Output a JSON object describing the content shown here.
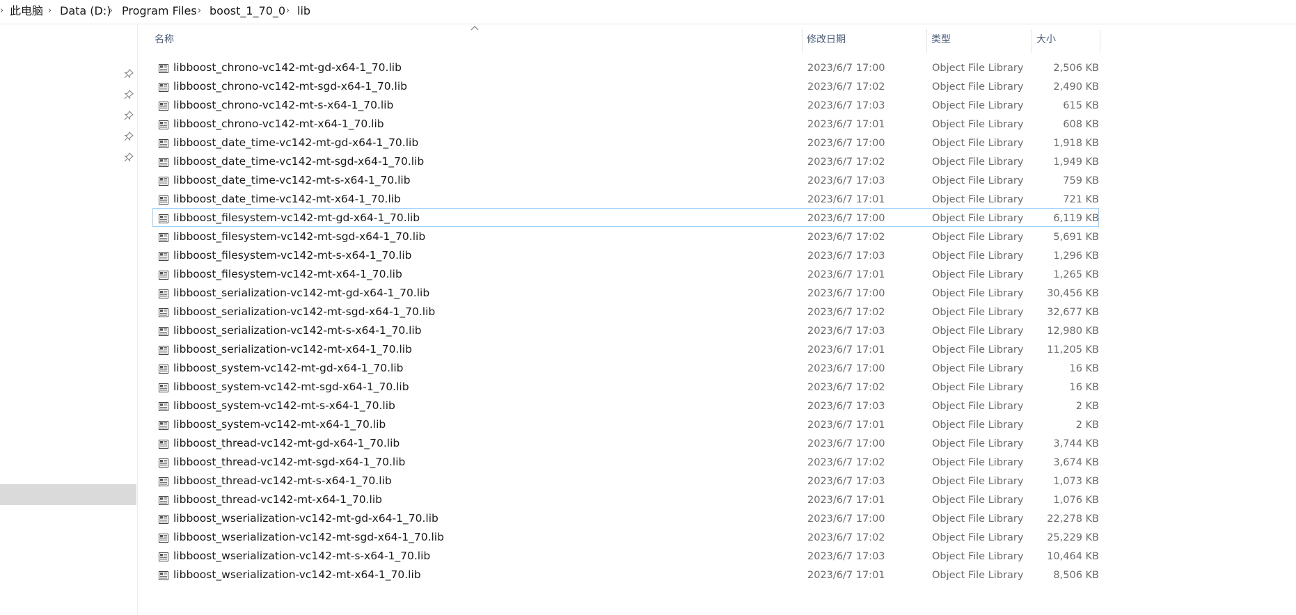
{
  "breadcrumb": [
    "此电脑",
    "Data (D:)",
    "Program Files",
    "boost_1_70_0",
    "lib"
  ],
  "columns": {
    "name": "名称",
    "modified": "修改日期",
    "type": "类型",
    "size": "大小"
  },
  "icons": {
    "breadcrumb_separator": "chevron-right-icon",
    "pin": "pin-icon",
    "file": "lib-file-icon",
    "sort": "sort-up-icon"
  },
  "colors": {
    "header_text": "#4c607a",
    "focus_border": "#99d1ff",
    "nav_selected": "#dadada",
    "secondary_text": "#6b6b6b"
  },
  "files": [
    {
      "name": "libboost_chrono-vc142-mt-gd-x64-1_70.lib",
      "modified": "2023/6/7 17:00",
      "type": "Object File Library",
      "size": "2,506 KB"
    },
    {
      "name": "libboost_chrono-vc142-mt-sgd-x64-1_70.lib",
      "modified": "2023/6/7 17:02",
      "type": "Object File Library",
      "size": "2,490 KB"
    },
    {
      "name": "libboost_chrono-vc142-mt-s-x64-1_70.lib",
      "modified": "2023/6/7 17:03",
      "type": "Object File Library",
      "size": "615 KB"
    },
    {
      "name": "libboost_chrono-vc142-mt-x64-1_70.lib",
      "modified": "2023/6/7 17:01",
      "type": "Object File Library",
      "size": "608 KB"
    },
    {
      "name": "libboost_date_time-vc142-mt-gd-x64-1_70.lib",
      "modified": "2023/6/7 17:00",
      "type": "Object File Library",
      "size": "1,918 KB"
    },
    {
      "name": "libboost_date_time-vc142-mt-sgd-x64-1_70.lib",
      "modified": "2023/6/7 17:02",
      "type": "Object File Library",
      "size": "1,949 KB"
    },
    {
      "name": "libboost_date_time-vc142-mt-s-x64-1_70.lib",
      "modified": "2023/6/7 17:03",
      "type": "Object File Library",
      "size": "759 KB"
    },
    {
      "name": "libboost_date_time-vc142-mt-x64-1_70.lib",
      "modified": "2023/6/7 17:01",
      "type": "Object File Library",
      "size": "721 KB"
    },
    {
      "name": "libboost_filesystem-vc142-mt-gd-x64-1_70.lib",
      "modified": "2023/6/7 17:00",
      "type": "Object File Library",
      "size": "6,119 KB",
      "focused": true
    },
    {
      "name": "libboost_filesystem-vc142-mt-sgd-x64-1_70.lib",
      "modified": "2023/6/7 17:02",
      "type": "Object File Library",
      "size": "5,691 KB"
    },
    {
      "name": "libboost_filesystem-vc142-mt-s-x64-1_70.lib",
      "modified": "2023/6/7 17:03",
      "type": "Object File Library",
      "size": "1,296 KB"
    },
    {
      "name": "libboost_filesystem-vc142-mt-x64-1_70.lib",
      "modified": "2023/6/7 17:01",
      "type": "Object File Library",
      "size": "1,265 KB"
    },
    {
      "name": "libboost_serialization-vc142-mt-gd-x64-1_70.lib",
      "modified": "2023/6/7 17:00",
      "type": "Object File Library",
      "size": "30,456 KB"
    },
    {
      "name": "libboost_serialization-vc142-mt-sgd-x64-1_70.lib",
      "modified": "2023/6/7 17:02",
      "type": "Object File Library",
      "size": "32,677 KB"
    },
    {
      "name": "libboost_serialization-vc142-mt-s-x64-1_70.lib",
      "modified": "2023/6/7 17:03",
      "type": "Object File Library",
      "size": "12,980 KB"
    },
    {
      "name": "libboost_serialization-vc142-mt-x64-1_70.lib",
      "modified": "2023/6/7 17:01",
      "type": "Object File Library",
      "size": "11,205 KB"
    },
    {
      "name": "libboost_system-vc142-mt-gd-x64-1_70.lib",
      "modified": "2023/6/7 17:00",
      "type": "Object File Library",
      "size": "16 KB"
    },
    {
      "name": "libboost_system-vc142-mt-sgd-x64-1_70.lib",
      "modified": "2023/6/7 17:02",
      "type": "Object File Library",
      "size": "16 KB"
    },
    {
      "name": "libboost_system-vc142-mt-s-x64-1_70.lib",
      "modified": "2023/6/7 17:03",
      "type": "Object File Library",
      "size": "2 KB"
    },
    {
      "name": "libboost_system-vc142-mt-x64-1_70.lib",
      "modified": "2023/6/7 17:01",
      "type": "Object File Library",
      "size": "2 KB"
    },
    {
      "name": "libboost_thread-vc142-mt-gd-x64-1_70.lib",
      "modified": "2023/6/7 17:00",
      "type": "Object File Library",
      "size": "3,744 KB"
    },
    {
      "name": "libboost_thread-vc142-mt-sgd-x64-1_70.lib",
      "modified": "2023/6/7 17:02",
      "type": "Object File Library",
      "size": "3,674 KB"
    },
    {
      "name": "libboost_thread-vc142-mt-s-x64-1_70.lib",
      "modified": "2023/6/7 17:03",
      "type": "Object File Library",
      "size": "1,073 KB"
    },
    {
      "name": "libboost_thread-vc142-mt-x64-1_70.lib",
      "modified": "2023/6/7 17:01",
      "type": "Object File Library",
      "size": "1,076 KB"
    },
    {
      "name": "libboost_wserialization-vc142-mt-gd-x64-1_70.lib",
      "modified": "2023/6/7 17:00",
      "type": "Object File Library",
      "size": "22,278 KB"
    },
    {
      "name": "libboost_wserialization-vc142-mt-sgd-x64-1_70.lib",
      "modified": "2023/6/7 17:02",
      "type": "Object File Library",
      "size": "25,229 KB"
    },
    {
      "name": "libboost_wserialization-vc142-mt-s-x64-1_70.lib",
      "modified": "2023/6/7 17:03",
      "type": "Object File Library",
      "size": "10,464 KB"
    },
    {
      "name": "libboost_wserialization-vc142-mt-x64-1_70.lib",
      "modified": "2023/6/7 17:01",
      "type": "Object File Library",
      "size": "8,506 KB"
    }
  ]
}
